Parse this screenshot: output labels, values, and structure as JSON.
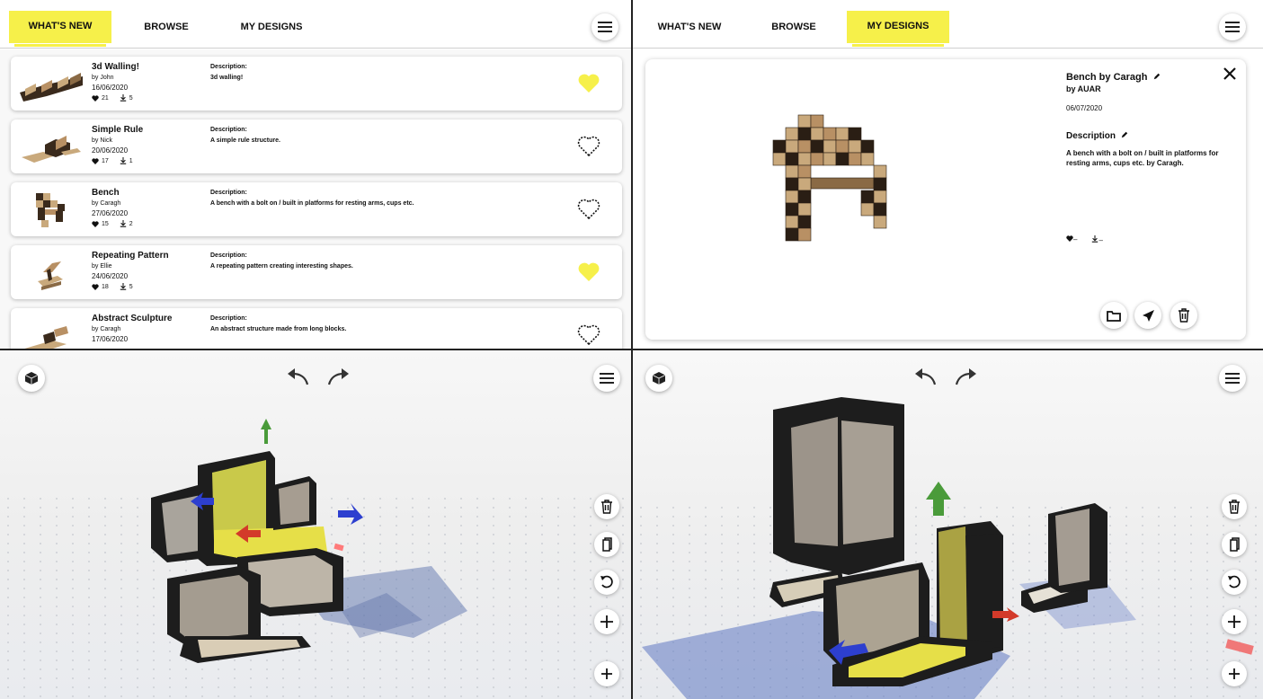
{
  "colors": {
    "accent": "#f6f04a",
    "liked": "#f6f04a"
  },
  "left_panel": {
    "tabs": [
      {
        "label": "WHAT'S NEW",
        "active": true
      },
      {
        "label": "BROWSE",
        "active": false
      },
      {
        "label": "MY DESIGNS",
        "active": false
      }
    ],
    "menu_icon": "hamburger-icon",
    "designs": [
      {
        "title": "3d Walling!",
        "author": "by John",
        "date": "16/06/2020",
        "likes": "21",
        "downloads": "5",
        "description_label": "Description:",
        "description": "3d walling!",
        "liked": true
      },
      {
        "title": "Simple Rule",
        "author": "by Nick",
        "date": "20/06/2020",
        "likes": "17",
        "downloads": "1",
        "description_label": "Description:",
        "description": "A simple rule structure.",
        "liked": false
      },
      {
        "title": "Bench",
        "author": "by Caragh",
        "date": "27/06/2020",
        "likes": "15",
        "downloads": "2",
        "description_label": "Description:",
        "description": "A bench with a bolt on / built in platforms for resting arms, cups etc.",
        "liked": false
      },
      {
        "title": "Repeating Pattern",
        "author": "by Ellie",
        "date": "24/06/2020",
        "likes": "18",
        "downloads": "5",
        "description_label": "Description:",
        "description": "A repeating pattern creating interesting shapes.",
        "liked": true
      },
      {
        "title": "Abstract Sculpture",
        "author": "by Caragh",
        "date": "17/06/2020",
        "likes": "",
        "downloads": "",
        "description_label": "Description:",
        "description": "An abstract structure made from long blocks.",
        "liked": false
      }
    ]
  },
  "right_panel": {
    "tabs": [
      {
        "label": "WHAT'S NEW",
        "active": false
      },
      {
        "label": "BROWSE",
        "active": false
      },
      {
        "label": "MY DESIGNS",
        "active": true
      }
    ],
    "detail": {
      "title": "Bench by Caragh",
      "author": "by AUAR",
      "date": "06/07/2020",
      "description_label": "Description",
      "description": "A bench with a bolt on / built in platforms for resting arms, cups etc. by Caragh.",
      "likes": "–",
      "downloads": "–",
      "actions": [
        "folder-icon",
        "send-icon",
        "trash-icon"
      ]
    }
  },
  "editor_tools": [
    "trash-icon",
    "copy-icon",
    "rotate-icon",
    "move-icon",
    "add-icon"
  ]
}
